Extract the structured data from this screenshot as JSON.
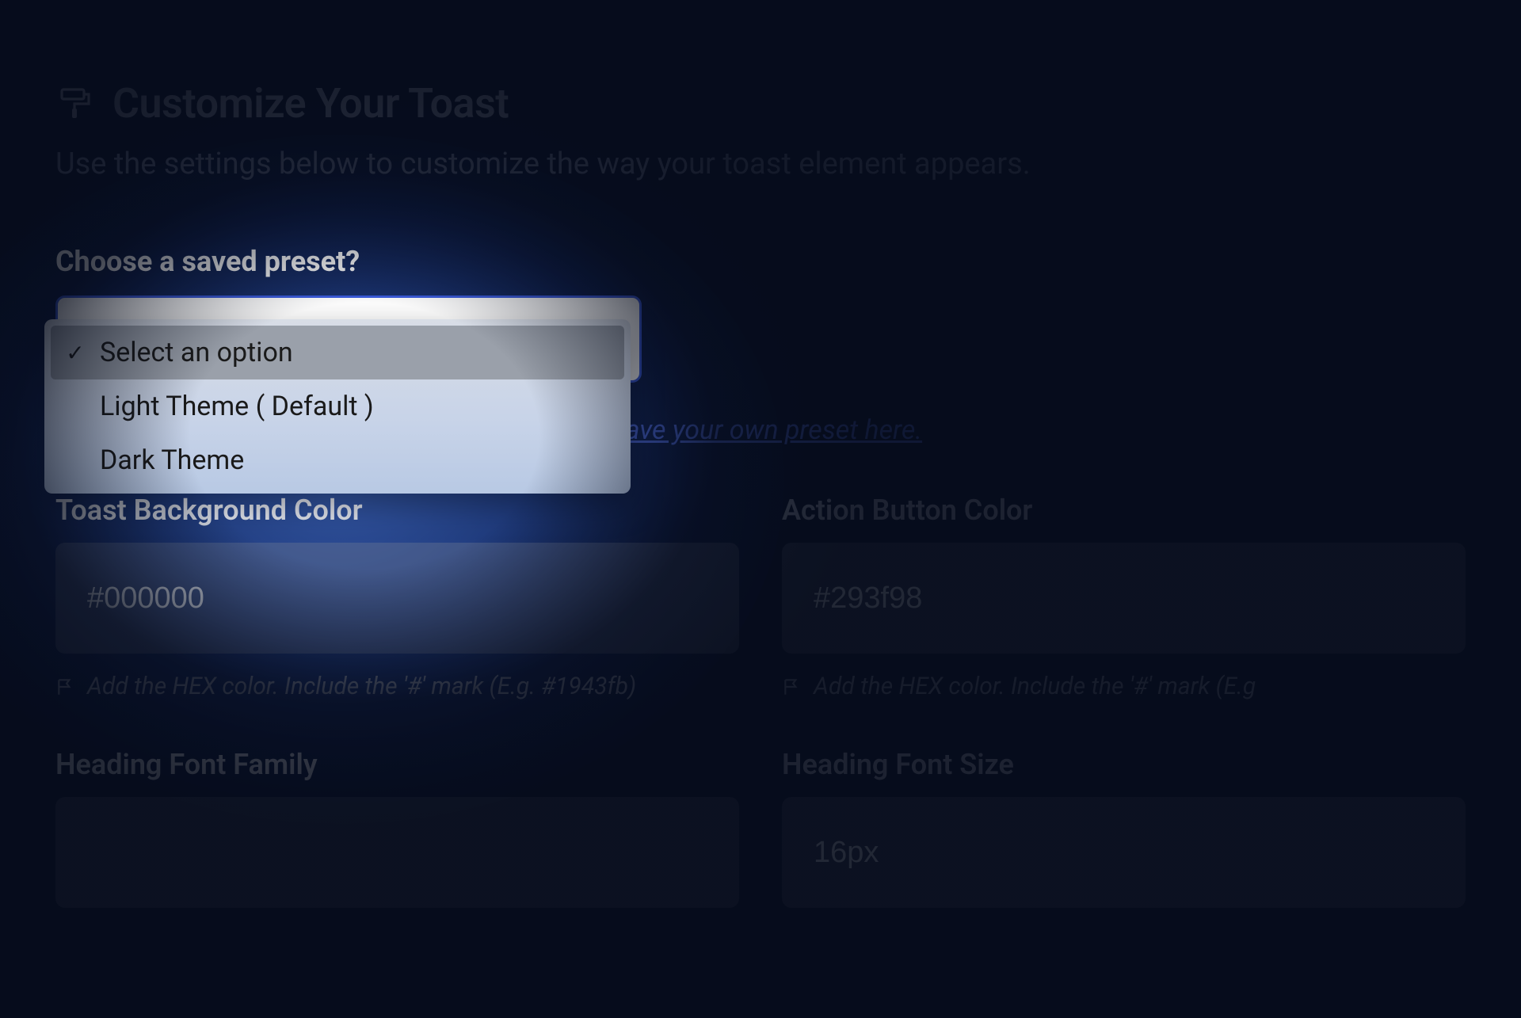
{
  "header": {
    "title": "Customize Your Toast",
    "subtitle": "Use the settings below to customize the way your toast element appears."
  },
  "preset": {
    "label": "Choose a saved preset?",
    "options": [
      "Select an option",
      "Light Theme ( Default )",
      "Dark Theme"
    ],
    "selected_index": 0,
    "save_link": "Save your own preset here."
  },
  "fields": {
    "bg_color": {
      "label": "Toast Background Color",
      "value": "#000000",
      "hint": "Add the HEX color. Include the '#' mark (E.g. #1943fb)"
    },
    "action_color": {
      "label": "Action Button Color",
      "value": "#293f98",
      "hint": "Add the HEX color. Include the '#' mark (E.g"
    },
    "heading_font_family": {
      "label": "Heading Font Family",
      "value": ""
    },
    "heading_font_size": {
      "label": "Heading Font Size",
      "value": "16px"
    }
  }
}
